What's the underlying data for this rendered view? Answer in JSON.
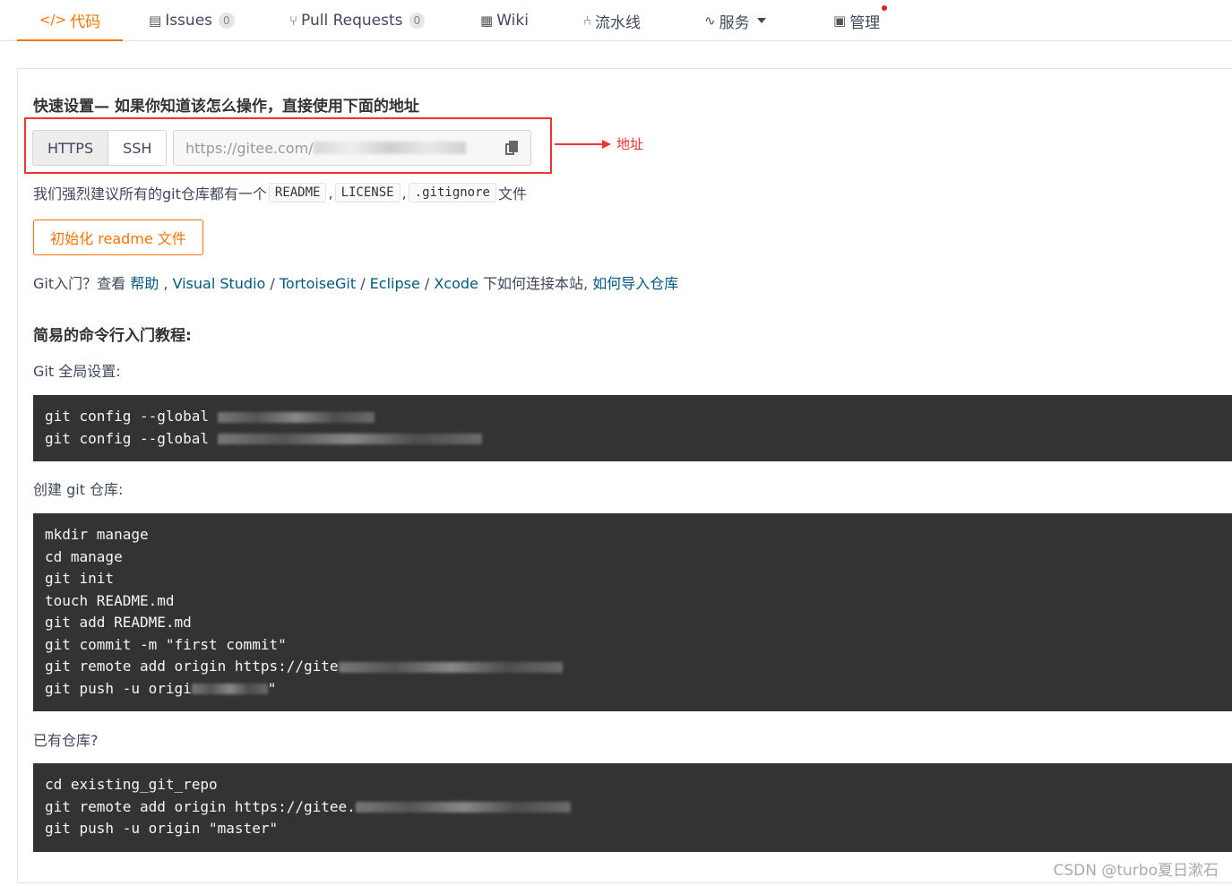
{
  "nav": {
    "tabs": [
      {
        "label": "代码",
        "icon": "code-icon"
      },
      {
        "label": "Issues",
        "icon": "issues-icon",
        "badge": "0"
      },
      {
        "label": "Pull Requests",
        "icon": "pull-request-icon",
        "badge": "0"
      },
      {
        "label": "Wiki",
        "icon": "wiki-icon"
      },
      {
        "label": "流水线",
        "icon": "pipeline-icon"
      },
      {
        "label": "服务",
        "icon": "pulse-icon"
      },
      {
        "label": "管理",
        "icon": "manage-icon"
      }
    ],
    "active_color": "#fe7300"
  },
  "quick": {
    "heading": "快速设置— 如果你知道该怎么操作，直接使用下面的地址",
    "https_label": "HTTPS",
    "ssh_label": "SSH",
    "url_visible": "https://gitee.com/",
    "annotation": "地址",
    "annotation_color": "#e33333"
  },
  "recommend": {
    "prefix": "我们强烈建议所有的git仓库都有一个",
    "readme": "README",
    "sep1": ",",
    "license": "LICENSE",
    "sep2": ",",
    "gitignore": ".gitignore",
    "suffix": "文件"
  },
  "init_button": "初始化 readme 文件",
  "help": {
    "prefix": "Git入门？查看 ",
    "link_help": "帮助",
    "sep1": " , ",
    "link_vs": "Visual Studio",
    "sep2": " / ",
    "link_tortoise": "TortoiseGit",
    "sep3": " / ",
    "link_eclipse": "Eclipse",
    "sep4": " / ",
    "link_xcode": "Xcode",
    "middle": " 下如何连接本站, ",
    "link_import": "如何导入仓库"
  },
  "tutorial": {
    "heading": "简易的命令行入门教程:",
    "global_label": "Git 全局设置:",
    "global_lines": [
      "git config --global",
      "git config --global"
    ],
    "create_label": "创建 git 仓库:",
    "create_lines": [
      "mkdir manage",
      "cd manage",
      "git init",
      "touch README.md",
      "git add README.md",
      "git commit -m \"first commit\"",
      "git remote add origin https://gite",
      "git push -u origi",
      "\""
    ],
    "existing_label": "已有仓库?",
    "existing_lines": [
      "cd existing_git_repo",
      "git remote add origin https://gitee.",
      "git push -u origin \"master\""
    ]
  },
  "watermark": "CSDN @turbo夏日漱石"
}
